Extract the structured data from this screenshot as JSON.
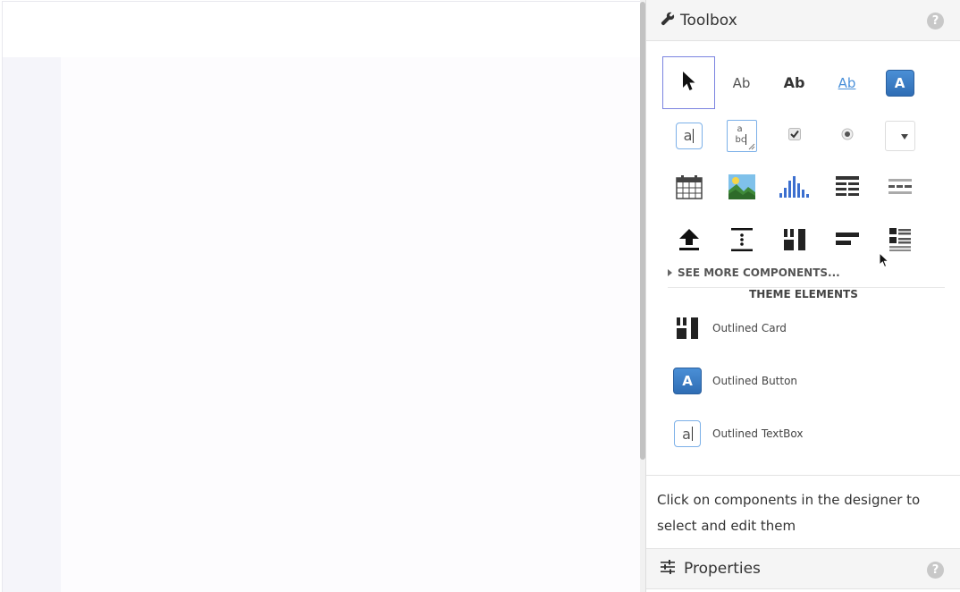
{
  "toolbox": {
    "title": "Toolbox",
    "help": "?",
    "tools": [
      {
        "name": "pointer-tool",
        "icon": "arrow-pointer-icon"
      },
      {
        "name": "label-tool",
        "icon": "label-icon",
        "text": "Ab"
      },
      {
        "name": "bold-label-tool",
        "icon": "bold-label-icon",
        "text": "Ab"
      },
      {
        "name": "link-tool",
        "icon": "link-icon",
        "text": "Ab"
      },
      {
        "name": "button-tool",
        "icon": "button-icon",
        "text": "A"
      },
      {
        "name": "textbox-tool",
        "icon": "textbox-icon",
        "text": "a"
      },
      {
        "name": "textarea-tool",
        "icon": "textarea-icon",
        "text": "a bc"
      },
      {
        "name": "checkbox-tool",
        "icon": "checkbox-icon"
      },
      {
        "name": "radio-tool",
        "icon": "radio-icon"
      },
      {
        "name": "dropdown-tool",
        "icon": "dropdown-icon"
      },
      {
        "name": "datepicker-tool",
        "icon": "calendar-icon"
      },
      {
        "name": "image-tool",
        "icon": "image-icon"
      },
      {
        "name": "plot-tool",
        "icon": "bar-chart-icon"
      },
      {
        "name": "datagrid-tool",
        "icon": "data-grid-icon"
      },
      {
        "name": "datagrid-lite-tool",
        "icon": "data-grid-light-icon"
      },
      {
        "name": "fileloader-tool",
        "icon": "upload-icon"
      },
      {
        "name": "spacer-tool",
        "icon": "spacer-icon"
      },
      {
        "name": "columnpanel-tool",
        "icon": "column-panel-icon"
      },
      {
        "name": "linearpanel-tool",
        "icon": "linear-panel-icon"
      },
      {
        "name": "repeatingpanel-tool",
        "icon": "repeating-panel-icon"
      }
    ],
    "see_more": "SEE MORE COMPONENTS...",
    "theme_title": "THEME ELEMENTS",
    "theme_items": [
      {
        "label": "Outlined Card",
        "icon": "column-panel-icon"
      },
      {
        "label": "Outlined Button",
        "icon": "button-icon",
        "text": "A"
      },
      {
        "label": "Outlined TextBox",
        "icon": "textbox-icon",
        "text": "a"
      }
    ],
    "hint": "Click on components in the designer to select and edit them"
  },
  "properties": {
    "title": "Properties",
    "help": "?"
  },
  "colors": {
    "accent": "#3a7bc8",
    "selection": "#7b83e0"
  }
}
